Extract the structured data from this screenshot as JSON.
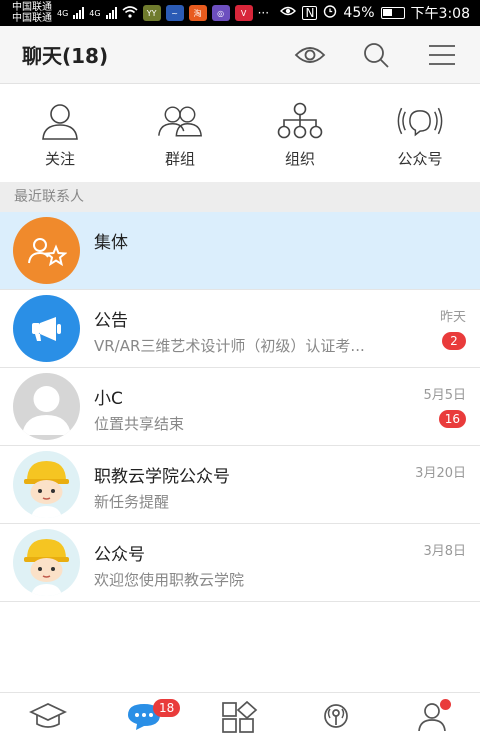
{
  "status_bar": {
    "carrier_1": "中国联通",
    "carrier_2": "中国联通",
    "network_1": "4G",
    "network_2": "4G",
    "app_badges": [
      {
        "label": "YY",
        "color": "#6f7b2d"
      },
      {
        "label": "~",
        "color": "#2b5bb5"
      },
      {
        "label": "淘",
        "color": "#e85b1e"
      },
      {
        "label": "◎",
        "color": "#6d4fbf"
      },
      {
        "label": "V",
        "color": "#d8263a"
      }
    ],
    "dots": "···",
    "battery": "45%",
    "time": "下午3:08"
  },
  "header": {
    "title": "聊天(18)",
    "icons": [
      "eye-icon",
      "search-icon",
      "menu-icon"
    ]
  },
  "quick_entries": [
    {
      "label": "关注",
      "icon": "person-icon"
    },
    {
      "label": "群组",
      "icon": "group-icon"
    },
    {
      "label": "组织",
      "icon": "org-tree-icon"
    },
    {
      "label": "公众号",
      "icon": "broadcast-icon"
    }
  ],
  "section_label": "最近联系人",
  "conversations": [
    {
      "name": "集体",
      "preview": "",
      "time": "",
      "badge": "",
      "avatar": "group-star-avatar",
      "avatar_color": "#f08a2c",
      "active": true
    },
    {
      "name": "公告",
      "preview": "VR/AR三维艺术设计师（初级）认证考...",
      "time": "昨天",
      "badge": "2",
      "avatar": "megaphone-avatar",
      "avatar_color": "#2a8fe6",
      "active": false
    },
    {
      "name": "小C",
      "preview": "位置共享结束",
      "time": "5月5日",
      "badge": "16",
      "avatar": "default-user-avatar",
      "avatar_color": "#d6d6d6",
      "active": false
    },
    {
      "name": "职教云学院公众号",
      "preview": "新任务提醒",
      "time": "3月20日",
      "badge": "",
      "avatar": "worker-avatar",
      "avatar_color": "#dff1f5",
      "active": false
    },
    {
      "name": "公众号",
      "preview": "欢迎您使用职教云学院",
      "time": "3月8日",
      "badge": "",
      "avatar": "worker-avatar",
      "avatar_color": "#dff1f5",
      "active": false
    }
  ],
  "bottom_nav": {
    "items": [
      {
        "icon": "graduation-cap-icon",
        "badge": ""
      },
      {
        "icon": "chat-bubble-icon",
        "badge": "18"
      },
      {
        "icon": "apps-grid-icon",
        "badge": ""
      },
      {
        "icon": "broadcast-signal-icon",
        "badge": ""
      },
      {
        "icon": "profile-icon",
        "badge": "dot"
      }
    ]
  },
  "colors": {
    "accent": "#2a8fe6",
    "badge": "#e93b3b",
    "active_row": "#dbeefc"
  }
}
